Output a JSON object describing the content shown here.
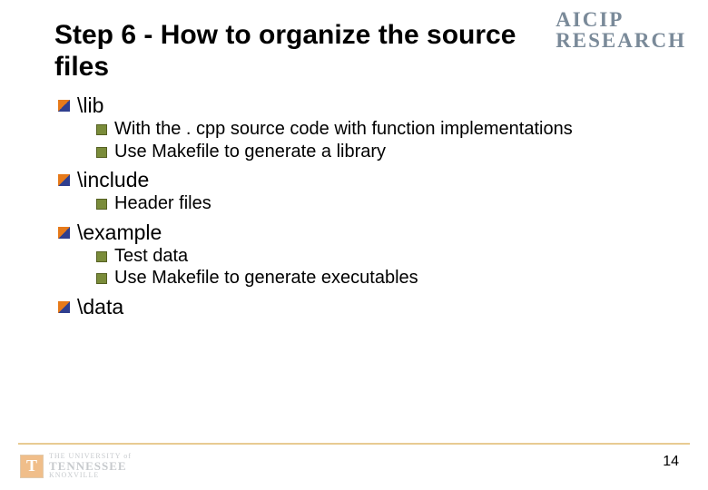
{
  "brand": {
    "line1": "AICIP",
    "line2": "Research"
  },
  "title": "Step 6 - How to organize the source files",
  "sections": {
    "s0": {
      "label": "\\lib"
    },
    "s0_0": "With the . cpp source code with function implementations",
    "s0_1": "Use Makefile to generate a library",
    "s1": {
      "label": "\\include"
    },
    "s1_0": "Header files",
    "s2": {
      "label": "\\example"
    },
    "s2_0": "Test data",
    "s2_1": "Use Makefile to generate executables",
    "s3": {
      "label": "\\data"
    }
  },
  "footer": {
    "page": "14",
    "uni": {
      "the": "THE UNIVERSITY of",
      "name": "TENNESSEE",
      "city": "KNOXVILLE",
      "t": "T"
    }
  }
}
